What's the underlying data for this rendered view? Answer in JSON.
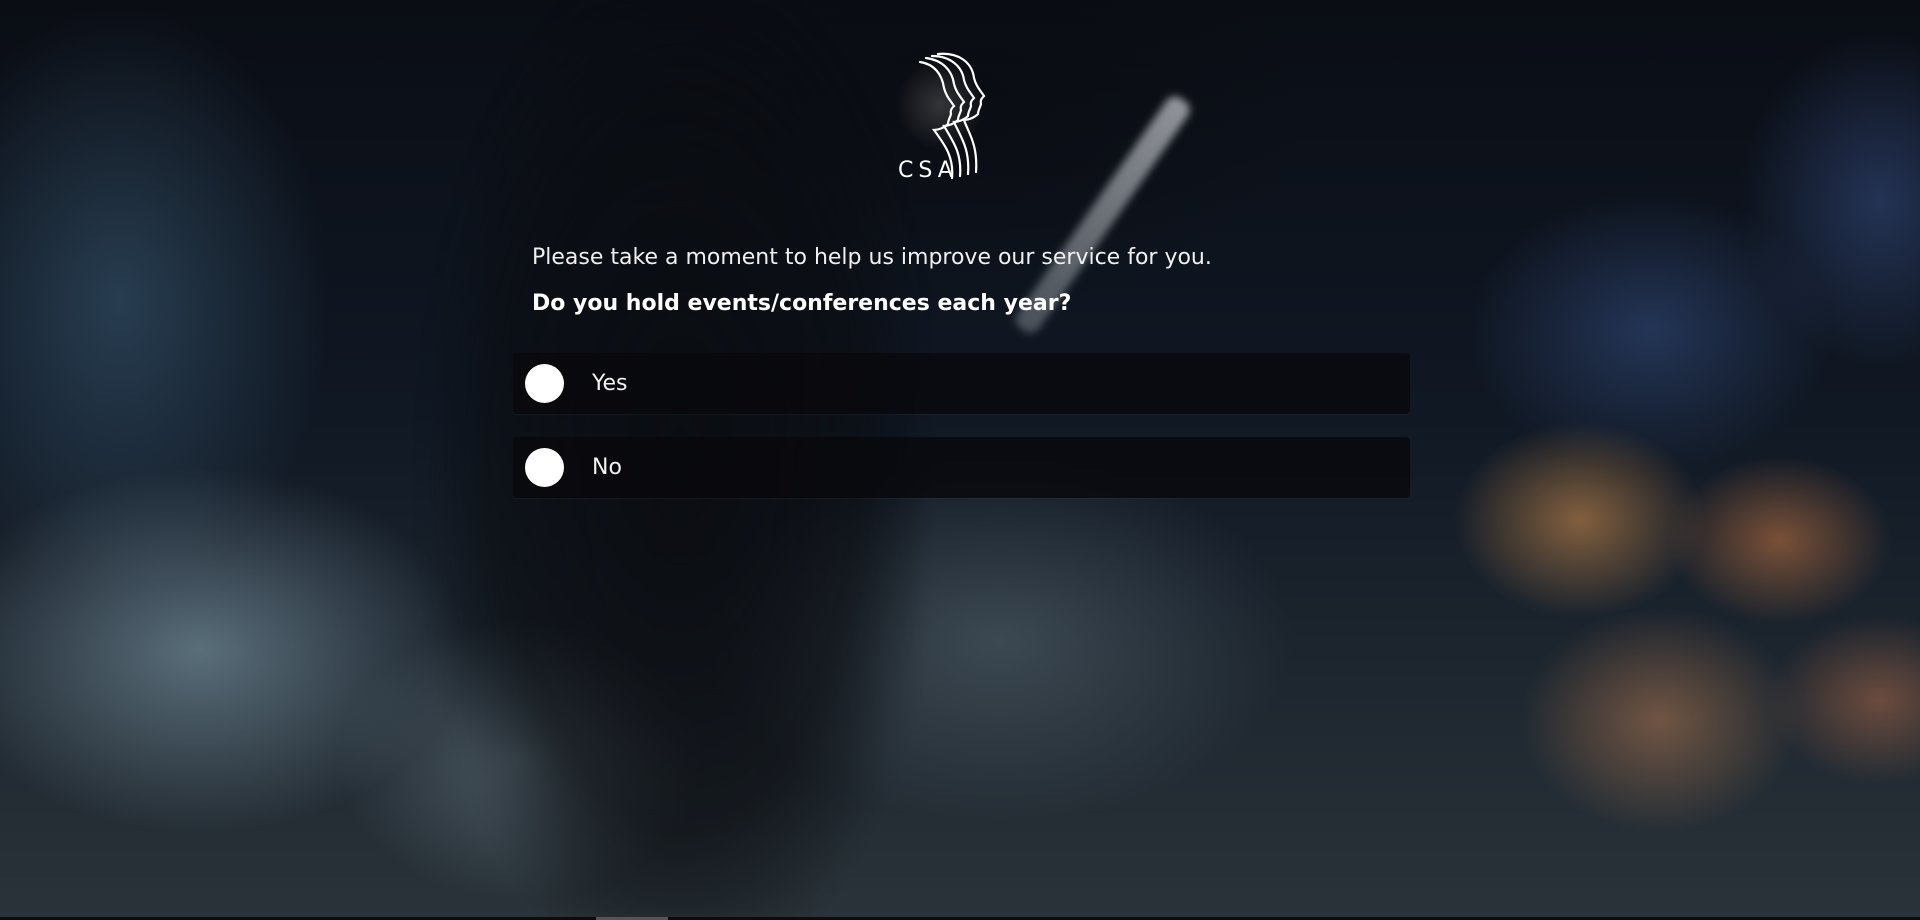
{
  "brand": {
    "logo_text": "CSA",
    "logo_icon": "profiles-logo-icon"
  },
  "survey": {
    "intro": "Please take a moment to help us improve our service for you.",
    "question": "Do you hold events/conferences each year?",
    "options": [
      {
        "label": "Yes",
        "selected": false
      },
      {
        "label": "No",
        "selected": false
      }
    ]
  },
  "colors": {
    "option_bg": "#08090c",
    "radio_fill": "#ffffff",
    "text": "#f0f0f0"
  }
}
